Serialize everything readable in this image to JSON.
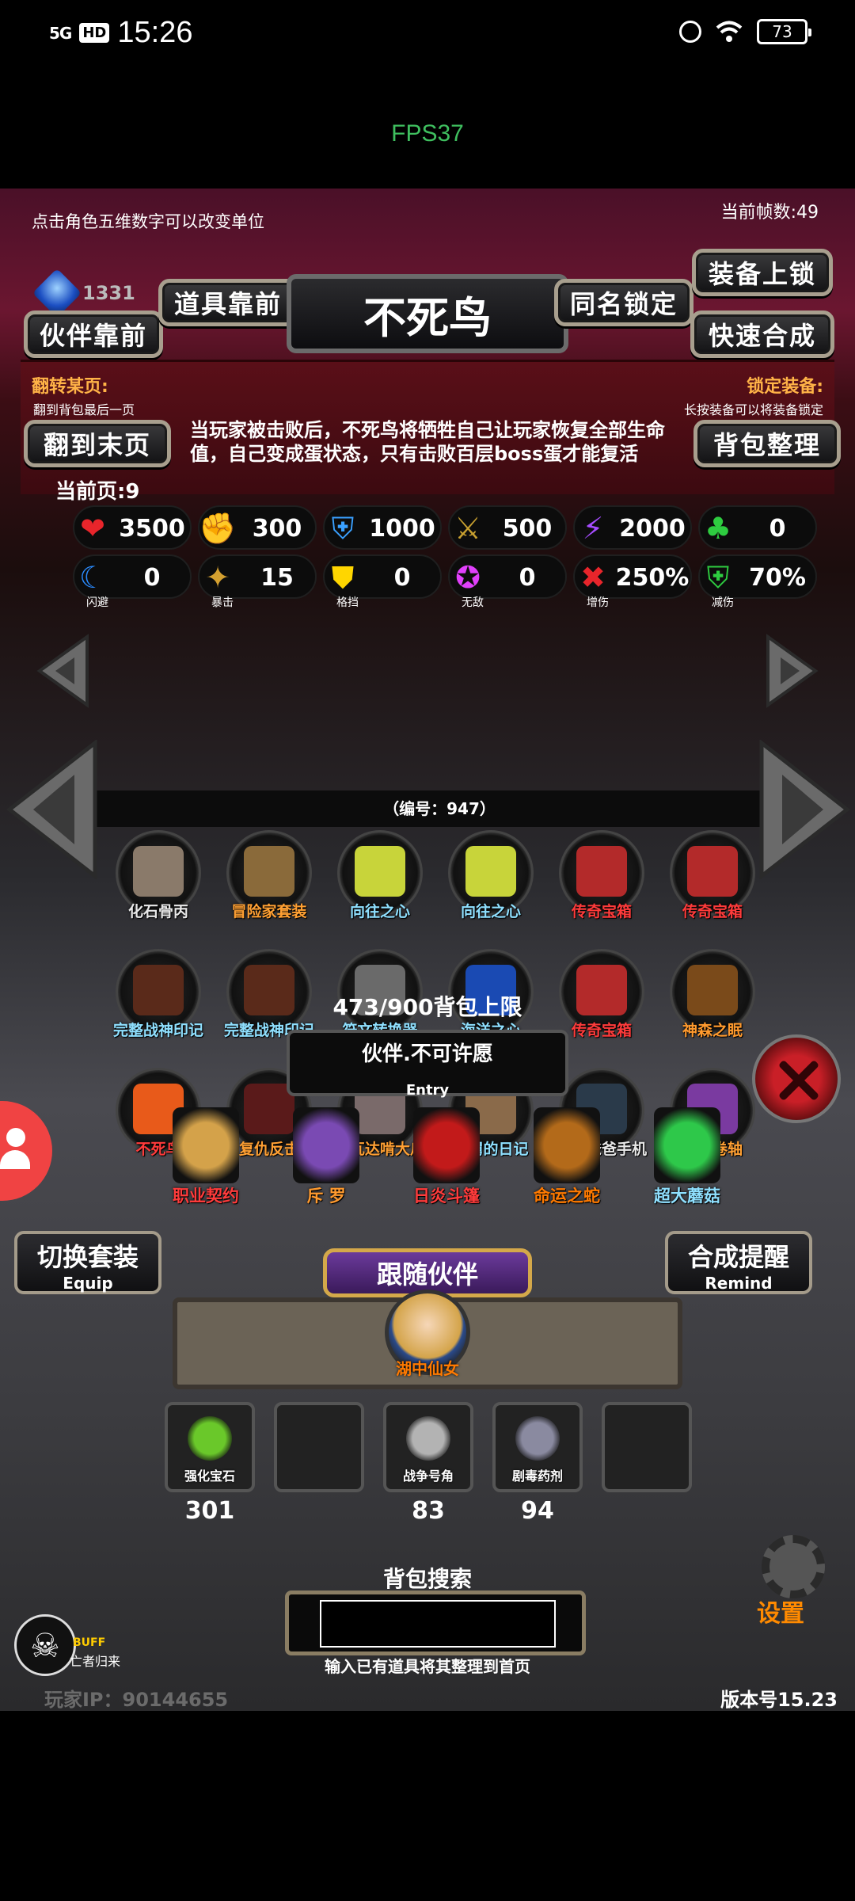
{
  "status_bar": {
    "network": "5G",
    "hd": "HD",
    "time": "15:26",
    "battery": "73"
  },
  "fps_label": "FPS37",
  "top_hint": "点击角色五维数字可以改变单位",
  "frame_count": "当前帧数:49",
  "gem_count": "1331",
  "buttons": {
    "companion_front": "伙伴靠前",
    "item_front": "道具靠前",
    "same_name_lock": "同名锁定",
    "equip_lock": "装备上锁",
    "quick_combine": "快速合成",
    "last_page": "翻到末页",
    "bag_sort": "背包整理"
  },
  "item_title": "不死鸟",
  "flip_label": "翻转某页:",
  "flip_sub": "翻到背包最后一页",
  "lock_label": "锁定装备:",
  "lock_sub": "长按装备可以将装备锁定",
  "description": "当玩家被击败后，不死鸟将牺牲自己让玩家恢复全部生命值，自己变成蛋状态，只有击败百层boss蛋才能复活",
  "current_page": "当前页:9",
  "stats_row1": [
    {
      "icon": "heart-icon",
      "glyph": "❤",
      "color": "#e8252b",
      "value": "3500"
    },
    {
      "icon": "strength-icon",
      "glyph": "✊",
      "color": "#c6b02a",
      "value": "300"
    },
    {
      "icon": "armor-icon",
      "glyph": "⛨",
      "color": "#3aa0ff",
      "value": "1000"
    },
    {
      "icon": "sword-icon",
      "glyph": "⚔",
      "color": "#c8a030",
      "value": "500"
    },
    {
      "icon": "lightning-icon",
      "glyph": "⚡",
      "color": "#a64cff",
      "value": "2000"
    },
    {
      "icon": "clover-icon",
      "glyph": "♣",
      "color": "#2ecc40",
      "value": "0"
    }
  ],
  "stats_row2": [
    {
      "icon": "dodge-icon",
      "glyph": "☾",
      "color": "#2a8bff",
      "value": "0",
      "label": "闪避"
    },
    {
      "icon": "crit-icon",
      "glyph": "✦",
      "color": "#d4a030",
      "value": "15",
      "label": "暴击"
    },
    {
      "icon": "block-icon",
      "glyph": "⛊",
      "color": "#ffd600",
      "value": "0",
      "label": "格挡"
    },
    {
      "icon": "invincible-icon",
      "glyph": "✪",
      "color": "#e040fb",
      "value": "0",
      "label": "无敌"
    },
    {
      "icon": "damage-up-icon",
      "glyph": "✖",
      "color": "#e8252b",
      "value": "250%",
      "label": "增伤"
    },
    {
      "icon": "damage-down-icon",
      "glyph": "⛨",
      "color": "#2ecc40",
      "value": "70%",
      "label": "减伤"
    }
  ],
  "item_id": "（编号：947）",
  "inventory": [
    {
      "name": "化石骨丙",
      "color": "n-white",
      "art": "#8a7a6a"
    },
    {
      "name": "冒险家套装",
      "color": "n-orange",
      "art": "#8a6a3a"
    },
    {
      "name": "向往之心",
      "color": "n-cyan",
      "art": "#c8d43a"
    },
    {
      "name": "向往之心",
      "color": "n-cyan",
      "art": "#c8d43a"
    },
    {
      "name": "传奇宝箱",
      "color": "n-red",
      "art": "#b32a2a"
    },
    {
      "name": "传奇宝箱",
      "color": "n-red",
      "art": "#b32a2a"
    },
    {
      "name": "完整战神印记",
      "color": "n-cyan",
      "art": "#5a2a1a"
    },
    {
      "name": "完整战神印记",
      "color": "n-cyan",
      "art": "#5a2a1a"
    },
    {
      "name": "符文转换器",
      "color": "n-cyan",
      "art": "#6a6a6a"
    },
    {
      "name": "海洋之心",
      "color": "n-cyan",
      "art": "#1a4ab3"
    },
    {
      "name": "传奇宝箱",
      "color": "n-red",
      "art": "#b32a2a"
    },
    {
      "name": "神森之眠",
      "color": "n-orange2",
      "art": "#7a4a1a"
    },
    {
      "name": "不死鸟",
      "color": "n-red",
      "art": "#e85a1a"
    },
    {
      "name": "复仇反击",
      "color": "n-orange",
      "art": "#5a1a1a"
    },
    {
      "name": "阿瓦达啃大瓜",
      "color": "n-orange",
      "art": "#7a6a6a"
    },
    {
      "name": "舅舅的日记",
      "color": "n-cyan",
      "art": "#8a6a4a"
    },
    {
      "name": "半瞎爸爸手机",
      "color": "n-white",
      "art": "#2a3a4a"
    },
    {
      "name": "登神卷轴",
      "color": "n-orange",
      "art": "#7a3aa0"
    }
  ],
  "bag_limit": "473/900背包上限",
  "entry_title": "伙伴.不可许愿",
  "entry_sub": "Entry",
  "companions": [
    {
      "name": "职业契约",
      "color": "#ff3b3b",
      "art": "#d4a24a"
    },
    {
      "name": "斥 罗",
      "color": "#ff9a2e",
      "art": "#7a4ab3"
    },
    {
      "name": "日炎斗篷",
      "color": "#ff3b3b",
      "art": "#c21a1a"
    },
    {
      "name": "命运之蛇",
      "color": "#ff7a00",
      "art": "#b36a1a"
    },
    {
      "name": "超大蘑菇",
      "color": "#8fe0ff",
      "art": "#2ec84a"
    }
  ],
  "switch_set": {
    "title": "切换套装",
    "sub": "Equip"
  },
  "combine_remind": {
    "title": "合成提醒",
    "sub": "Remind"
  },
  "follow_title": "跟随伙伴",
  "follow_name": "湖中仙女",
  "consumables": [
    {
      "name": "强化宝石",
      "count": "301",
      "art": "#6ac82a"
    },
    {
      "name": "",
      "count": "",
      "art": ""
    },
    {
      "name": "战争号角",
      "count": "83",
      "art": "#b3b3b3"
    },
    {
      "name": "剧毒药剂",
      "count": "94",
      "art": "#8a8aa0"
    },
    {
      "name": "",
      "count": "",
      "art": ""
    }
  ],
  "search_label": "背包搜索",
  "search_value": "",
  "search_hint": "输入已有道具将其整理到首页",
  "buff_label": "BUFF",
  "buff_sub": "亡者归来",
  "settings_label": "设置",
  "player_ip": "玩家IP：90144655",
  "version": "版本号15.23"
}
